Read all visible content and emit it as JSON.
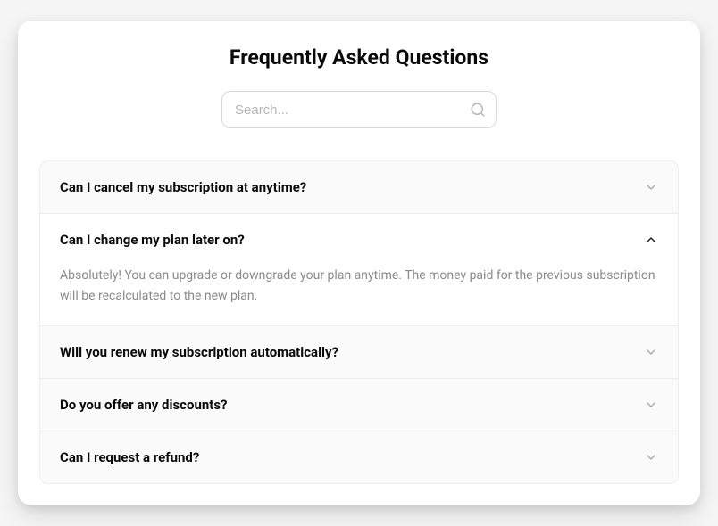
{
  "title": "Frequently Asked Questions",
  "search": {
    "placeholder": "Search..."
  },
  "faq": [
    {
      "question": "Can I cancel my subscription at anytime?",
      "expanded": false
    },
    {
      "question": "Can I change my plan later on?",
      "answer": "Absolutely! You can upgrade or downgrade your plan anytime. The money paid for the previous subscription will be recalculated to the new plan.",
      "expanded": true
    },
    {
      "question": "Will you renew my subscription automatically?",
      "expanded": false
    },
    {
      "question": "Do you offer any discounts?",
      "expanded": false
    },
    {
      "question": "Can I request a refund?",
      "expanded": false
    }
  ]
}
